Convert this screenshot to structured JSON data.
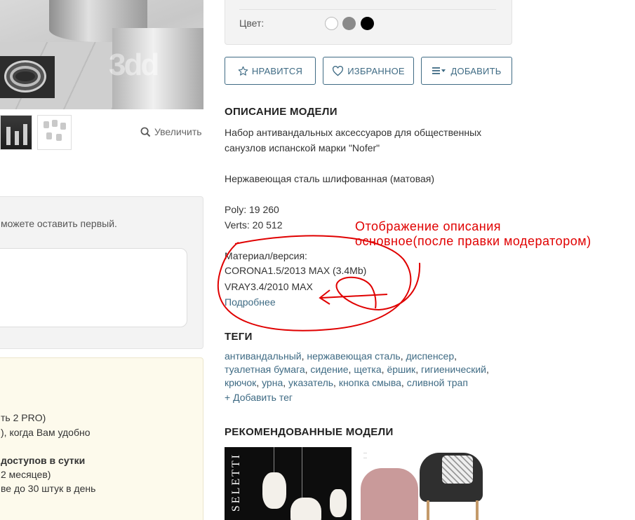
{
  "gallery": {
    "zoom_label": "Увеличить"
  },
  "comments": {
    "empty_hint": "можете оставить первый."
  },
  "pro_panel": {
    "line1": "ть 2 PRO)",
    "line2": "), когда Вам удобно",
    "line3": "доступов в сутки",
    "line4": "2 месяцев)",
    "line5": "ве до 30 штук в день"
  },
  "colors": {
    "label": "Цвет:",
    "swatches": [
      "#ffffff",
      "#8a8a8a",
      "#000000"
    ]
  },
  "actions": {
    "like": "НРАВИТСЯ",
    "favorite": "ИЗБРАННОЕ",
    "add": "ДОБАВИТЬ"
  },
  "description": {
    "heading": "ОПИСАНИЕ МОДЕЛИ",
    "line1": "Набор антивандальных аксессуаров для общественных",
    "line2": "санузлов испанской марки \"Nofer\"",
    "material": "Нержавеющая сталь шлифованная (матовая)",
    "poly": "Poly: 19 260",
    "verts": "Verts: 20 512",
    "version_label": "Материал/версия:",
    "version1": "CORONA1.5/2013 MAX (3.4Mb)",
    "version2": "VRAY3.4/2010 MAX",
    "more_link": "Подробнее"
  },
  "tags": {
    "heading": "ТЕГИ",
    "row1": [
      "антивандальный",
      "нержавеющая сталь",
      "диспенсер"
    ],
    "row2": [
      "туалетная бумага",
      "сидение",
      "щетка",
      "ёршик",
      "гигиенический"
    ],
    "row3": [
      "крючок",
      "урна",
      "указатель",
      "кнопка смыва",
      "сливной трап"
    ],
    "add_tag": "+ Добавить тег"
  },
  "recommended": {
    "heading": "РЕКОМЕНДОВАННЫЕ МОДЕЛИ",
    "item1_brand": "SELETTI"
  },
  "annotation": {
    "line1": "Отображение описания",
    "line2": "основное(после правки модератором)",
    "color": "#e00000"
  }
}
